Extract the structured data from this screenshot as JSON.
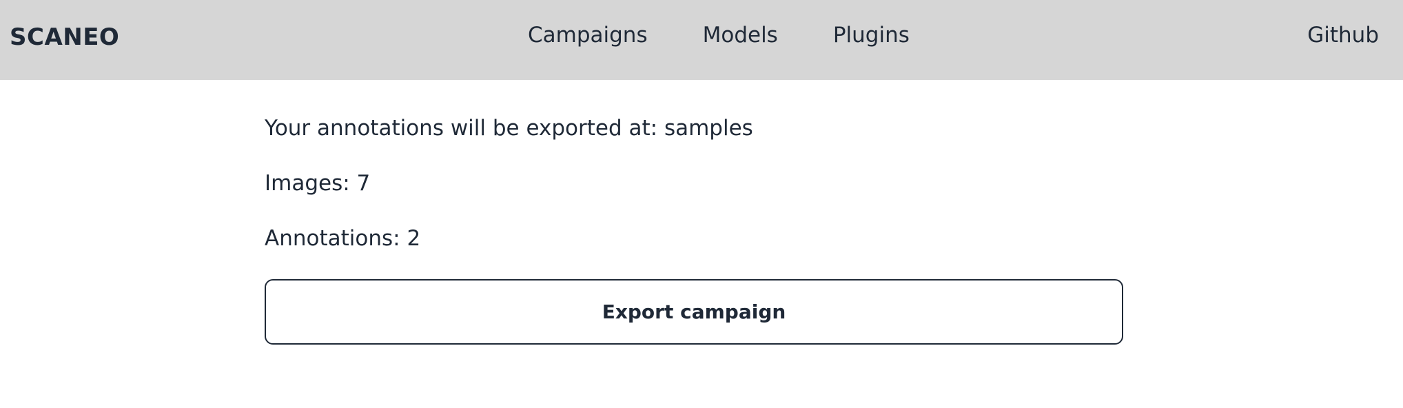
{
  "navbar": {
    "brand": "SCANEO",
    "links": [
      {
        "label": "Campaigns"
      },
      {
        "label": "Models"
      },
      {
        "label": "Plugins"
      }
    ],
    "github": "Github"
  },
  "main": {
    "export_path_text": "Your annotations will be exported at: samples",
    "images_text": "Images: 7",
    "annotations_text": "Annotations: 2",
    "export_button_label": "Export campaign"
  },
  "colors": {
    "navbar_bg": "#d6d6d6",
    "text": "#1f2937",
    "background": "#ffffff"
  }
}
